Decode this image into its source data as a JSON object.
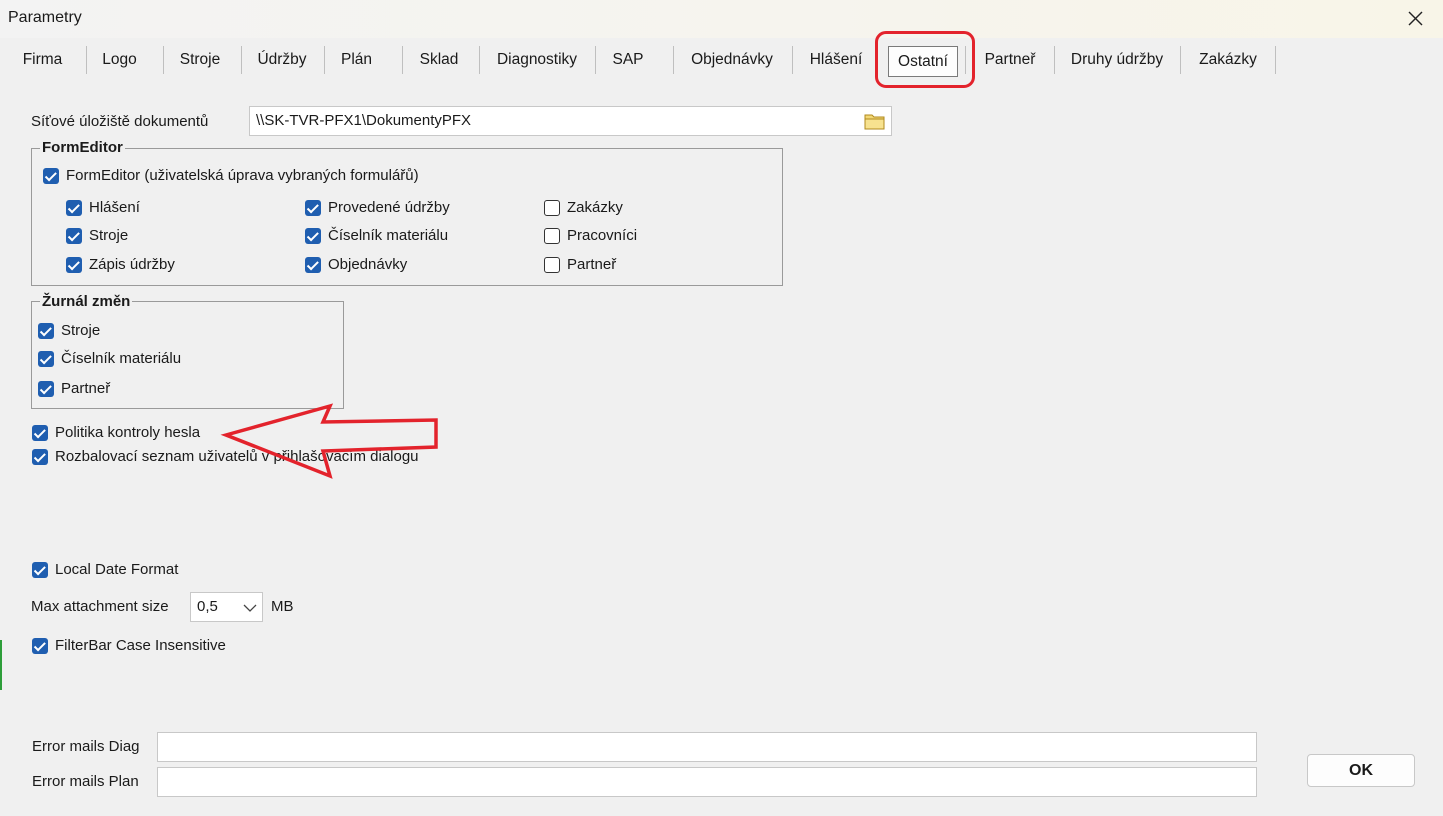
{
  "window": {
    "title": "Parametry"
  },
  "tabs": [
    {
      "label": "Firma"
    },
    {
      "label": "Logo"
    },
    {
      "label": "Stroje"
    },
    {
      "label": "Údržby"
    },
    {
      "label": "Plán"
    },
    {
      "label": "Sklad"
    },
    {
      "label": "Diagnostiky"
    },
    {
      "label": "SAP"
    },
    {
      "label": "Objednávky"
    },
    {
      "label": "Hlášení"
    },
    {
      "label": "Ostatní"
    },
    {
      "label": "Partneř"
    },
    {
      "label": "Druhy údržby"
    },
    {
      "label": "Zakázky"
    }
  ],
  "active_tab": "Ostatní",
  "storage": {
    "label": "Síťové úložiště dokumentů",
    "value": "\\\\SK-TVR-PFX1\\DokumentyPFX"
  },
  "form_editor": {
    "title": "FormEditor",
    "main": {
      "label": "FormEditor (uživatelská úprava vybraných formulářů)",
      "checked": true
    },
    "items": [
      {
        "label": "Hlášení",
        "checked": true
      },
      {
        "label": "Stroje",
        "checked": true
      },
      {
        "label": "Zápis údržby",
        "checked": true
      },
      {
        "label": "Provedené údržby",
        "checked": true
      },
      {
        "label": "Číselník materiálu",
        "checked": true
      },
      {
        "label": "Objednávky",
        "checked": true
      },
      {
        "label": "Zakázky",
        "checked": false
      },
      {
        "label": "Pracovníci",
        "checked": false
      },
      {
        "label": "Partneř",
        "checked": false
      }
    ]
  },
  "journal": {
    "title": "Žurnál změn",
    "items": [
      {
        "label": "Stroje",
        "checked": true
      },
      {
        "label": "Číselník materiálu",
        "checked": true
      },
      {
        "label": "Partneř",
        "checked": true
      }
    ]
  },
  "options": {
    "password_policy": {
      "label": "Politika kontroly hesla",
      "checked": true
    },
    "user_dropdown": {
      "label": "Rozbalovací seznam uživatelů v přihlašovacím dialogu",
      "checked": true
    },
    "local_date": {
      "label": "Local Date Format",
      "checked": true
    },
    "filterbar": {
      "label": "FilterBar Case Insensitive",
      "checked": true
    }
  },
  "attachment": {
    "label": "Max attachment size",
    "value": "0,5",
    "unit": "MB"
  },
  "error_mails": {
    "diag_label": "Error mails Diag",
    "diag_value": "",
    "plan_label": "Error mails Plan",
    "plan_value": ""
  },
  "ok_button": {
    "label": "OK"
  },
  "colors": {
    "accent": "#1f5eb0",
    "annotation": "#e3232c"
  }
}
